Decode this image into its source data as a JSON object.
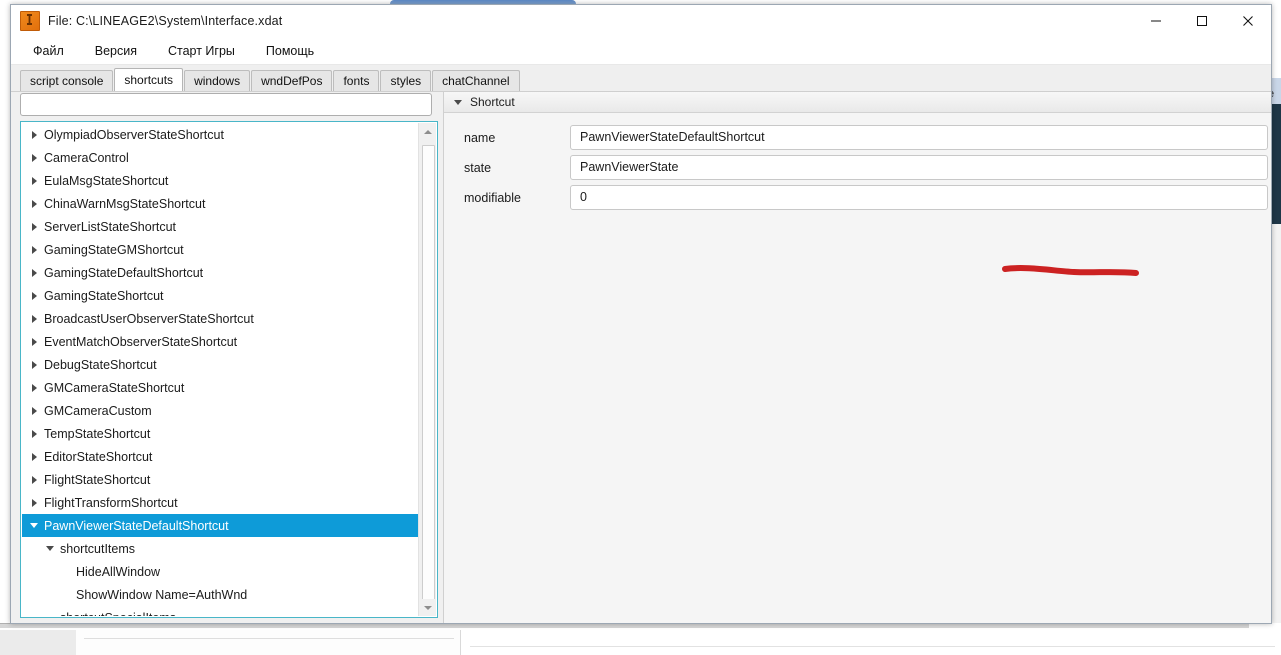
{
  "window": {
    "title": "File: C:\\LINEAGE2\\System\\Interface.xdat",
    "icon": "lineage2-app-icon",
    "controls": {
      "minimize": "minimize-icon",
      "maximize": "maximize-icon",
      "close": "close-icon"
    }
  },
  "menubar": {
    "items": [
      {
        "label": "Файл"
      },
      {
        "label": "Версия"
      },
      {
        "label": "Старт Игры"
      },
      {
        "label": "Помощь"
      }
    ]
  },
  "tabs": {
    "active": "shortcuts",
    "items": [
      {
        "label": "script console",
        "active": false
      },
      {
        "label": "shortcuts",
        "active": true
      },
      {
        "label": "windows",
        "active": false
      },
      {
        "label": "wndDefPos",
        "active": false
      },
      {
        "label": "fonts",
        "active": false
      },
      {
        "label": "styles",
        "active": false
      },
      {
        "label": "chatChannel",
        "active": false
      }
    ]
  },
  "left_pane": {
    "filter": {
      "value": "",
      "placeholder": ""
    },
    "dropdown_icon": "chevron-down-icon",
    "tree": [
      {
        "label": "OlympiadObserverStateShortcut",
        "depth": 0,
        "twisty": "right",
        "selected": false
      },
      {
        "label": "CameraControl",
        "depth": 0,
        "twisty": "right",
        "selected": false
      },
      {
        "label": "EulaMsgStateShortcut",
        "depth": 0,
        "twisty": "right",
        "selected": false
      },
      {
        "label": "ChinaWarnMsgStateShortcut",
        "depth": 0,
        "twisty": "right",
        "selected": false
      },
      {
        "label": "ServerListStateShortcut",
        "depth": 0,
        "twisty": "right",
        "selected": false
      },
      {
        "label": "GamingStateGMShortcut",
        "depth": 0,
        "twisty": "right",
        "selected": false
      },
      {
        "label": "GamingStateDefaultShortcut",
        "depth": 0,
        "twisty": "right",
        "selected": false
      },
      {
        "label": "GamingStateShortcut",
        "depth": 0,
        "twisty": "right",
        "selected": false
      },
      {
        "label": "BroadcastUserObserverStateShortcut",
        "depth": 0,
        "twisty": "right",
        "selected": false
      },
      {
        "label": "EventMatchObserverStateShortcut",
        "depth": 0,
        "twisty": "right",
        "selected": false
      },
      {
        "label": "DebugStateShortcut",
        "depth": 0,
        "twisty": "right",
        "selected": false
      },
      {
        "label": "GMCameraStateShortcut",
        "depth": 0,
        "twisty": "right",
        "selected": false
      },
      {
        "label": "GMCameraCustom",
        "depth": 0,
        "twisty": "right",
        "selected": false
      },
      {
        "label": "TempStateShortcut",
        "depth": 0,
        "twisty": "right",
        "selected": false
      },
      {
        "label": "EditorStateShortcut",
        "depth": 0,
        "twisty": "right",
        "selected": false
      },
      {
        "label": "FlightStateShortcut",
        "depth": 0,
        "twisty": "right",
        "selected": false
      },
      {
        "label": "FlightTransformShortcut",
        "depth": 0,
        "twisty": "right",
        "selected": false
      },
      {
        "label": "PawnViewerStateDefaultShortcut",
        "depth": 0,
        "twisty": "down",
        "selected": true
      },
      {
        "label": "shortcutItems",
        "depth": 1,
        "twisty": "down",
        "selected": false
      },
      {
        "label": "HideAllWindow",
        "depth": 2,
        "twisty": "none",
        "selected": false
      },
      {
        "label": "ShowWindow Name=AuthWnd",
        "depth": 2,
        "twisty": "none",
        "selected": false
      },
      {
        "label": "shortcutSpecialItems",
        "depth": 1,
        "twisty": "none",
        "selected": false
      }
    ],
    "scrollbar": {
      "up_icon": "scroll-up-arrow-icon",
      "down_icon": "scroll-down-arrow-icon"
    }
  },
  "right_pane": {
    "group": {
      "title": "Shortcut",
      "caret_icon": "caret-down-icon"
    },
    "fields": [
      {
        "label": "name",
        "value": "PawnViewerStateDefaultShortcut"
      },
      {
        "label": "state",
        "value": "PawnViewerState"
      },
      {
        "label": "modifiable",
        "value": "0"
      }
    ],
    "annotation": {
      "name": "red-underline-marker",
      "color": "#cc2222"
    }
  },
  "background": {
    "right_window_title": "te"
  }
}
